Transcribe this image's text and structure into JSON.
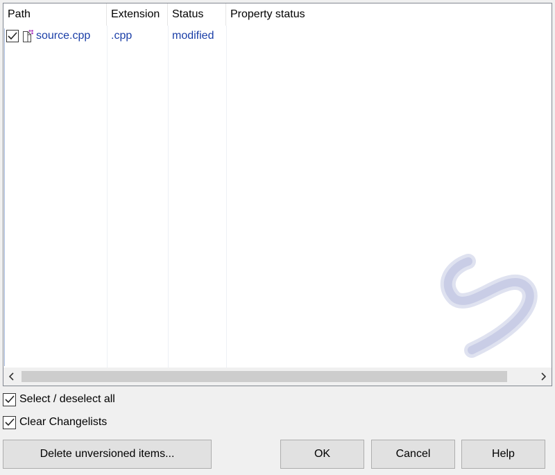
{
  "list": {
    "columns": [
      "Path",
      "Extension",
      "Status",
      "Property status"
    ],
    "rows": [
      {
        "checked": true,
        "icon": "modified-file-icon",
        "path": "source.cpp",
        "extension": ".cpp",
        "status": "modified",
        "property_status": ""
      }
    ]
  },
  "options": {
    "select_all_label": "Select / deselect all",
    "clear_changelists_label": "Clear Changelists"
  },
  "buttons": {
    "delete_unversioned": "Delete unversioned items...",
    "ok": "OK",
    "cancel": "Cancel",
    "help": "Help"
  },
  "colors": {
    "item_text": "#1a3ea7",
    "watermark": "#c9cde6"
  }
}
